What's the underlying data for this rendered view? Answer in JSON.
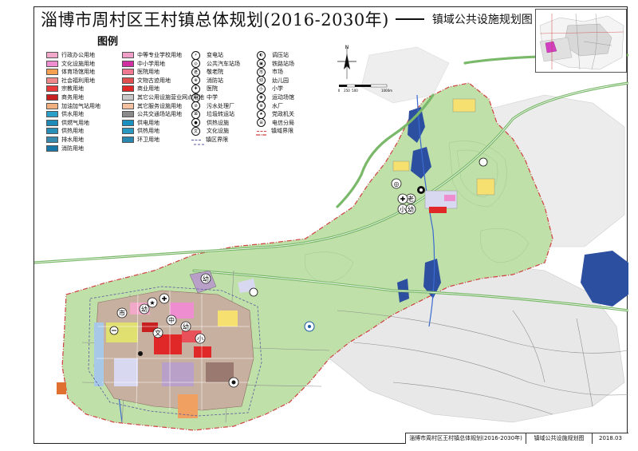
{
  "title": {
    "main": "淄博市周村区王村镇总体规划(2016-2030年)",
    "sub": "镇域公共设施规划图"
  },
  "legend": {
    "heading": "图例",
    "columns": [
      [
        {
          "label": "行政办公用地",
          "color": "#f2a8c8"
        },
        {
          "label": "文化设施用地",
          "color": "#ee8ed0"
        },
        {
          "label": "体育场馆用地",
          "color": "#f5a050"
        },
        {
          "label": "社会福利用地",
          "color": "#f08a8a"
        },
        {
          "label": "宗教用地",
          "color": "#e83a3a"
        },
        {
          "label": "商务用地",
          "color": "#c82020"
        },
        {
          "label": "加油加气站用地",
          "color": "#f0b080"
        },
        {
          "label": "供水用地",
          "color": "#2aa0c8"
        },
        {
          "label": "供燃气用地",
          "color": "#1f8ab8"
        },
        {
          "label": "供热用地",
          "color": "#2890b8"
        },
        {
          "label": "排水用地",
          "color": "#3a8ab0"
        },
        {
          "label": "消防用地",
          "color": "#1a78a8"
        }
      ],
      [
        {
          "label": "中等专业学校用地",
          "color": "#f0a0c8"
        },
        {
          "label": "中小学用地",
          "color": "#d030a0"
        },
        {
          "label": "医院用地",
          "color": "#f07890"
        },
        {
          "label": "文物古迹用地",
          "color": "#e05050"
        },
        {
          "label": "商业用地",
          "color": "#e02828"
        },
        {
          "label": "其它公用设施营业网点用地",
          "color": "#c8c8c8"
        },
        {
          "label": "其它服务设施用地",
          "color": "#f4c0a0"
        },
        {
          "label": "公共交通场站用地",
          "color": "#8a8a8a"
        },
        {
          "label": "供电用地",
          "color": "#1a90c0"
        },
        {
          "label": "供热用地",
          "color": "#2a98c0"
        },
        {
          "label": "环卫用地",
          "color": "#2a88b0"
        }
      ],
      [
        {
          "label": "变电站",
          "glyph": "⚡"
        },
        {
          "label": "公共汽车站场",
          "glyph": "◎"
        },
        {
          "label": "敬老院",
          "glyph": "老"
        },
        {
          "label": "消防站",
          "glyph": "⊕"
        },
        {
          "label": "医院",
          "glyph": "✚"
        },
        {
          "label": "中学",
          "glyph": "中"
        },
        {
          "label": "污水处理厂",
          "glyph": "⊘"
        },
        {
          "label": "垃圾转运站",
          "glyph": "⊠"
        },
        {
          "label": "供热设施",
          "glyph": "●"
        },
        {
          "label": "文化设施",
          "glyph": "文"
        },
        {
          "label": "镇区界限",
          "glyph": "line"
        }
      ],
      [
        {
          "label": "调压站",
          "glyph": "◐"
        },
        {
          "label": "铁路站场",
          "glyph": "▣"
        },
        {
          "label": "市场",
          "glyph": "市"
        },
        {
          "label": "幼儿园",
          "glyph": "幼"
        },
        {
          "label": "小学",
          "glyph": "小"
        },
        {
          "label": "运动场馆",
          "glyph": "◉"
        },
        {
          "label": "水厂",
          "glyph": "⊗"
        },
        {
          "label": "党政机关",
          "glyph": "★"
        },
        {
          "label": "电信分局",
          "glyph": "⊞"
        },
        {
          "label": "镇域界限",
          "glyph": "boundary"
        }
      ]
    ]
  },
  "scale": {
    "labels": [
      "0",
      "250",
      "500",
      "1000m"
    ]
  },
  "north": "N",
  "map_markers": [
    {
      "glyph": "老",
      "name": "nursing-home-marker"
    },
    {
      "glyph": "✚",
      "name": "hospital-marker"
    },
    {
      "glyph": "小",
      "name": "primary-school-marker"
    },
    {
      "glyph": "幼",
      "name": "kindergarten-marker"
    },
    {
      "glyph": "◎",
      "name": "bus-station-marker"
    },
    {
      "glyph": "中",
      "name": "middle-school-marker"
    },
    {
      "glyph": "市",
      "name": "market-marker"
    },
    {
      "glyph": "文",
      "name": "culture-marker"
    },
    {
      "glyph": "★",
      "name": "government-marker"
    }
  ],
  "footer": {
    "plan": "淄博市周村区王村镇总体规划(2016-2030年)",
    "sheet": "镇域公共设施规划图",
    "date": "2018.03"
  },
  "colors": {
    "town_green": "#b8dca0",
    "hills_gray": "#d8d8d8",
    "water_blue": "#2d4fa0",
    "road_green": "#7ab86a",
    "boundary_red": "#d04040",
    "town_red": "#e02828"
  }
}
